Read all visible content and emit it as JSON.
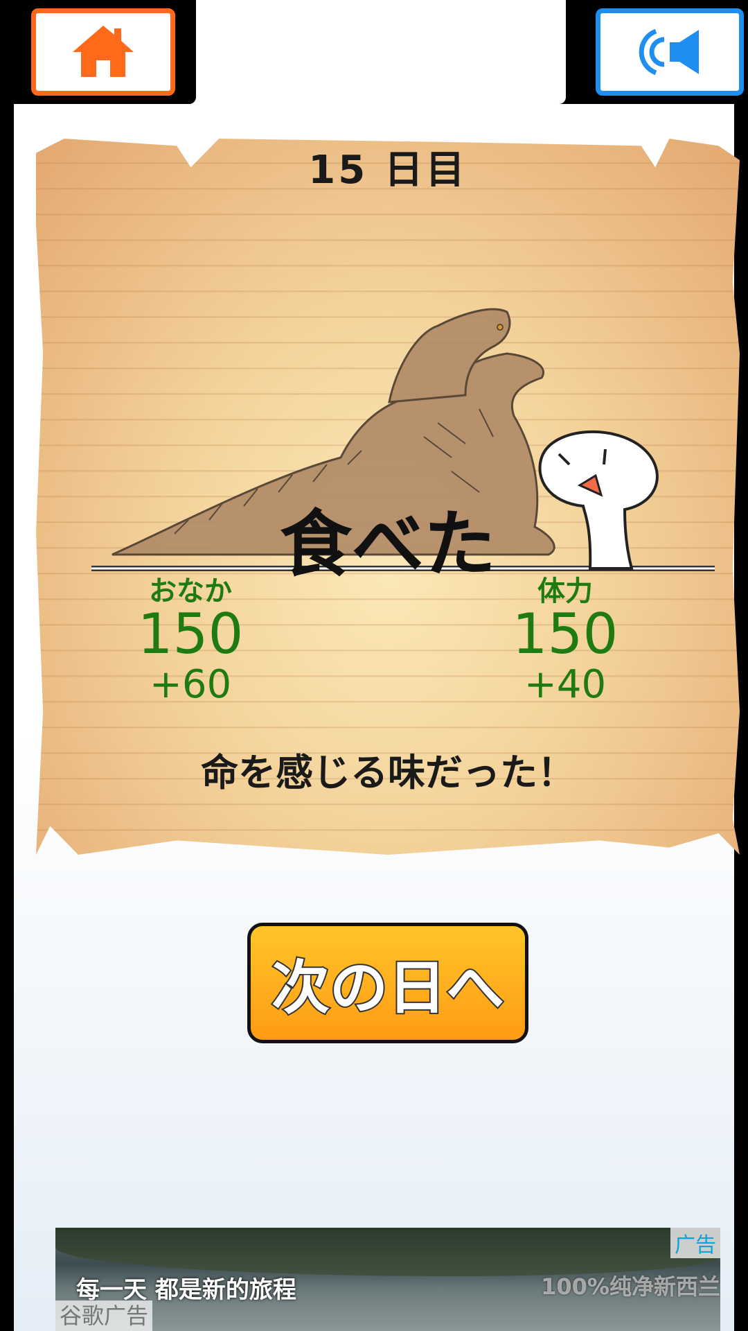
{
  "header": {
    "home_icon": "home-icon",
    "sound_icon": "speaker-icon",
    "home_color": "#ff6a1a",
    "sound_color": "#1e8ff0"
  },
  "card": {
    "day_label": "15 日目",
    "result_title": "食べた",
    "stats": [
      {
        "label": "おなか",
        "value": "150",
        "delta": "+60"
      },
      {
        "label": "体力",
        "value": "150",
        "delta": "+40"
      }
    ],
    "message": "命を感じる味だった！",
    "stat_color": "#1f7a12"
  },
  "next_day_button": {
    "label": "次の日へ"
  },
  "ad": {
    "badge": "广告",
    "headline": "每一天  都是新的旅程",
    "right_text": "100%纯净新西兰",
    "google_label": "谷歌广告"
  }
}
